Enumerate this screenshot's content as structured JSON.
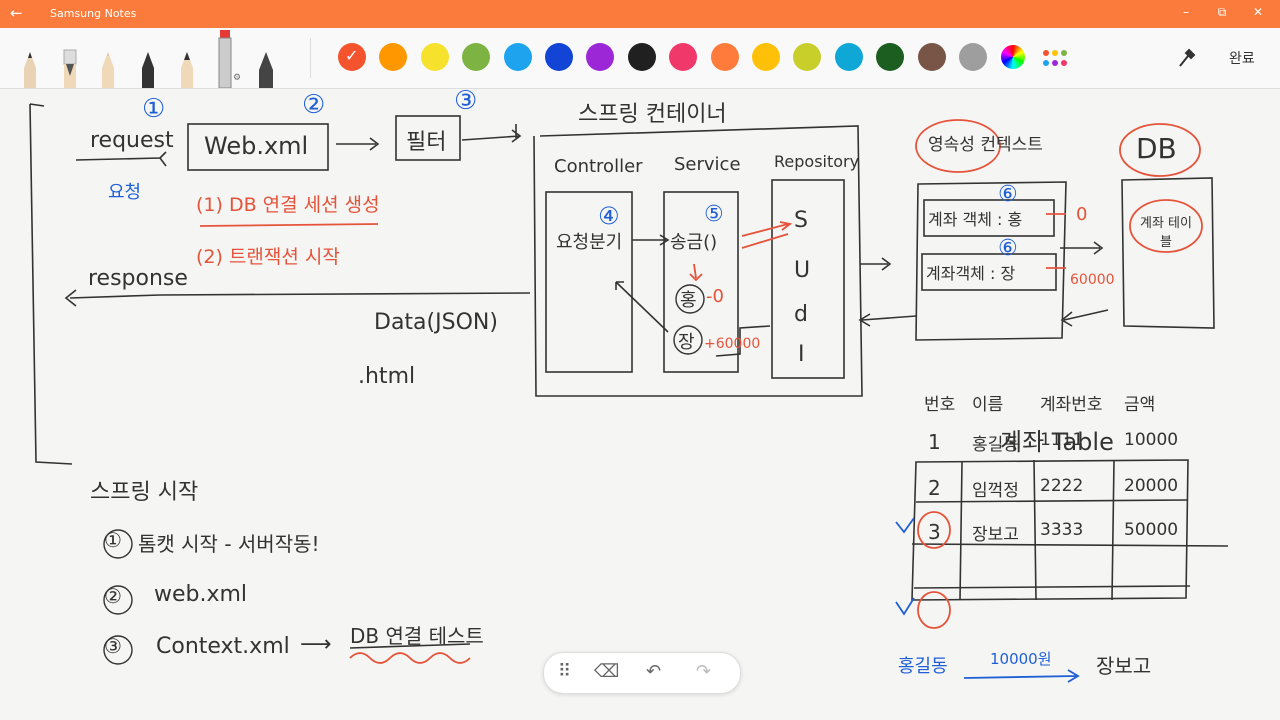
{
  "app": {
    "title": "Samsung Notes",
    "back_glyph": "←",
    "done_label": "완료"
  },
  "window": {
    "minimize": "–",
    "restore": "⧉",
    "close": "✕"
  },
  "pens": [
    "pen-icon",
    "fountain-pen-icon",
    "pencil-icon",
    "marker-icon",
    "brush-icon",
    "highlighter-icon",
    "calligraphy-pen-icon"
  ],
  "palette": [
    "#f4542d",
    "#ff9800",
    "#f6e12c",
    "#7cb342",
    "#1ea4ef",
    "#1245d6",
    "#9c27d6",
    "#202020",
    "#f0386b",
    "#ff7b3b",
    "#ffc107",
    "#c9cf2a",
    "#0fa7d6",
    "#1b5e20",
    "#795548",
    "#9e9e9e"
  ],
  "floatbar": {
    "drag": "⠿",
    "eraser": "⌫",
    "undo": "↶",
    "redo": "↷"
  },
  "note": {
    "flow": {
      "n1": "①",
      "n2": "②",
      "n3": "③",
      "n4": "④",
      "n5": "⑤",
      "n6a": "⑥",
      "n6b": "⑥",
      "request": "request",
      "request_sub": "요청",
      "webxml": "Web.xml",
      "filter": "필터",
      "db_conn": "(1) DB 연결 세션 생성",
      "tx_start": "(2) 트랜잭션 시작",
      "response": "response",
      "data_json": "Data(JSON)",
      "html": ".html"
    },
    "container": {
      "title": "스프링 컨테이너",
      "controller": "Controller",
      "service": "Service",
      "repository": "Repository",
      "ctrl_box": "요청분기",
      "svc_box": "송금()",
      "svc_hong": "홍",
      "svc_hong_val": "-0",
      "svc_jang": "장",
      "svc_jang_val": "+60000",
      "crud": [
        "S",
        "U",
        "d",
        "I"
      ]
    },
    "persistence": {
      "title": "영속성 컨텍스트",
      "row1": "계좌 객체 : 홍",
      "row1_val": "0",
      "row2": "계좌객체 : 장",
      "row2_val": "60000",
      "db": "DB",
      "db_table": "계좌 테이블"
    },
    "account_table": {
      "title": "계좌 Table",
      "headers": [
        "번호",
        "이름",
        "계좌번호",
        "금액"
      ],
      "rows": [
        [
          "1",
          "홍길동",
          "1111",
          "10000"
        ],
        [
          "2",
          "임꺽정",
          "2222",
          "20000"
        ],
        [
          "3",
          "장보고",
          "3333",
          "50000"
        ]
      ],
      "transfer_from": "홍길동",
      "transfer_amount": "10000원",
      "transfer_to": "장보고"
    },
    "spring_start": {
      "title": "스프링 시작",
      "step1": "톰캣 시작 - 서버작동!",
      "step2": "web.xml",
      "step3": "Context.xml",
      "step3_result": "DB 연결 테스트",
      "num1": "①",
      "num2": "②",
      "num3": "③",
      "arrow": "⟶"
    }
  }
}
